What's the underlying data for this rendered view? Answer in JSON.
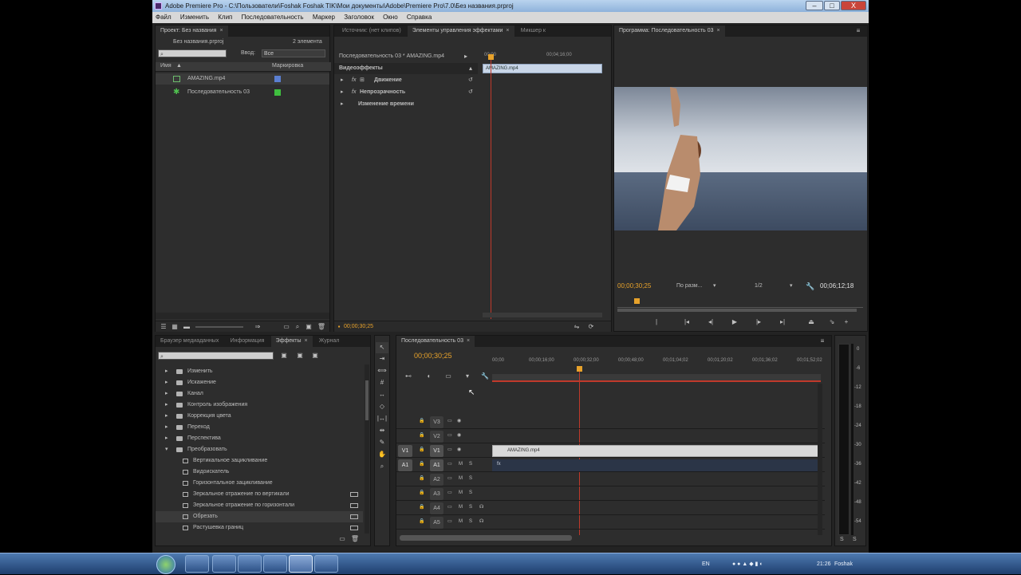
{
  "window": {
    "title": "Adobe Premiere Pro - C:\\Пользователи\\Foshak Foshak TIK\\Мои документы\\Adobe\\Premiere Pro\\7.0\\Без названия.prproj",
    "min": "–",
    "max": "□",
    "close": "X"
  },
  "menu": [
    "Файл",
    "Изменить",
    "Клип",
    "Последовательность",
    "Маркер",
    "Заголовок",
    "Окно",
    "Справка"
  ],
  "project": {
    "tab": "Проект: Без названия",
    "file": "Без названия.prproj",
    "count": "2 элемента",
    "search_placeholder": "",
    "in_label": "Ввод:",
    "in_value": "Все",
    "col_name": "Имя",
    "col_marker": "Маркировка",
    "items": [
      {
        "name": "AMAZING.mp4",
        "color": "#5b7fd1"
      },
      {
        "name": "Последовательность 03",
        "color": "#3fbf3f"
      }
    ]
  },
  "source_tabs": [
    "Источник: (нет клипов)",
    "Элементы управления эффектами",
    "Микшер к"
  ],
  "effect_controls": {
    "header": "Последовательность 03 * AMAZING.mp4",
    "ruler_start": "00:00",
    "ruler_end": "00;04;16;00",
    "clip": "AMAZING.mp4",
    "section": "Видеоэффекты",
    "effects": [
      "Движение",
      "Непрозрачность",
      "Изменение времени"
    ],
    "timecode": "00;00;30;25"
  },
  "program": {
    "tab": "Программа: Последовательность 03",
    "timecode": "00;00;30;25",
    "fit": "По разм...",
    "res": "1/2",
    "duration": "00;06;12;18"
  },
  "effects_panel": {
    "tabs": [
      "Браузер медиаданных",
      "Информация",
      "Эффекты",
      "Журнал"
    ],
    "folders": [
      "Изменить",
      "Искажение",
      "Канал",
      "Контроль изображения",
      "Коррекция цвета",
      "Переход",
      "Перспектива",
      "Преобразовать"
    ],
    "items": [
      "Вертикальное зацикливание",
      "Видоискатель",
      "Горизонтальное зацикливание",
      "Зеркальное отражение по вертикали",
      "Зеркальное отражение по горизонтали",
      "Обрезать",
      "Растушевка границ"
    ]
  },
  "timeline": {
    "tab": "Последовательность 03",
    "timecode": "00;00;30;25",
    "ruler": [
      "00;00",
      "00;00;16;00",
      "00;00;32;00",
      "00;00;48;00",
      "00;01;04;02",
      "00;01;20;02",
      "00;01;36;02",
      "00;01;52;02"
    ],
    "video_tracks": [
      "V3",
      "V2",
      "V1"
    ],
    "audio_tracks": [
      "A1",
      "A2",
      "A3",
      "A4",
      "A5"
    ],
    "src_v": "V1",
    "src_a": "A1",
    "clip_video": "AMAZING.mp4",
    "clip_audio": "fx"
  },
  "meter": {
    "labels": [
      "0",
      "-6",
      "-12",
      "-18",
      "-24",
      "-30",
      "-36",
      "-42",
      "-48",
      "-54"
    ]
  },
  "taskbar": {
    "lang": "EN",
    "time": "21:26",
    "user": "Foshak"
  },
  "colors": {
    "accent": "#e7a22b",
    "playhead": "#c0392b",
    "selected_clip": "#c9d6e8"
  }
}
